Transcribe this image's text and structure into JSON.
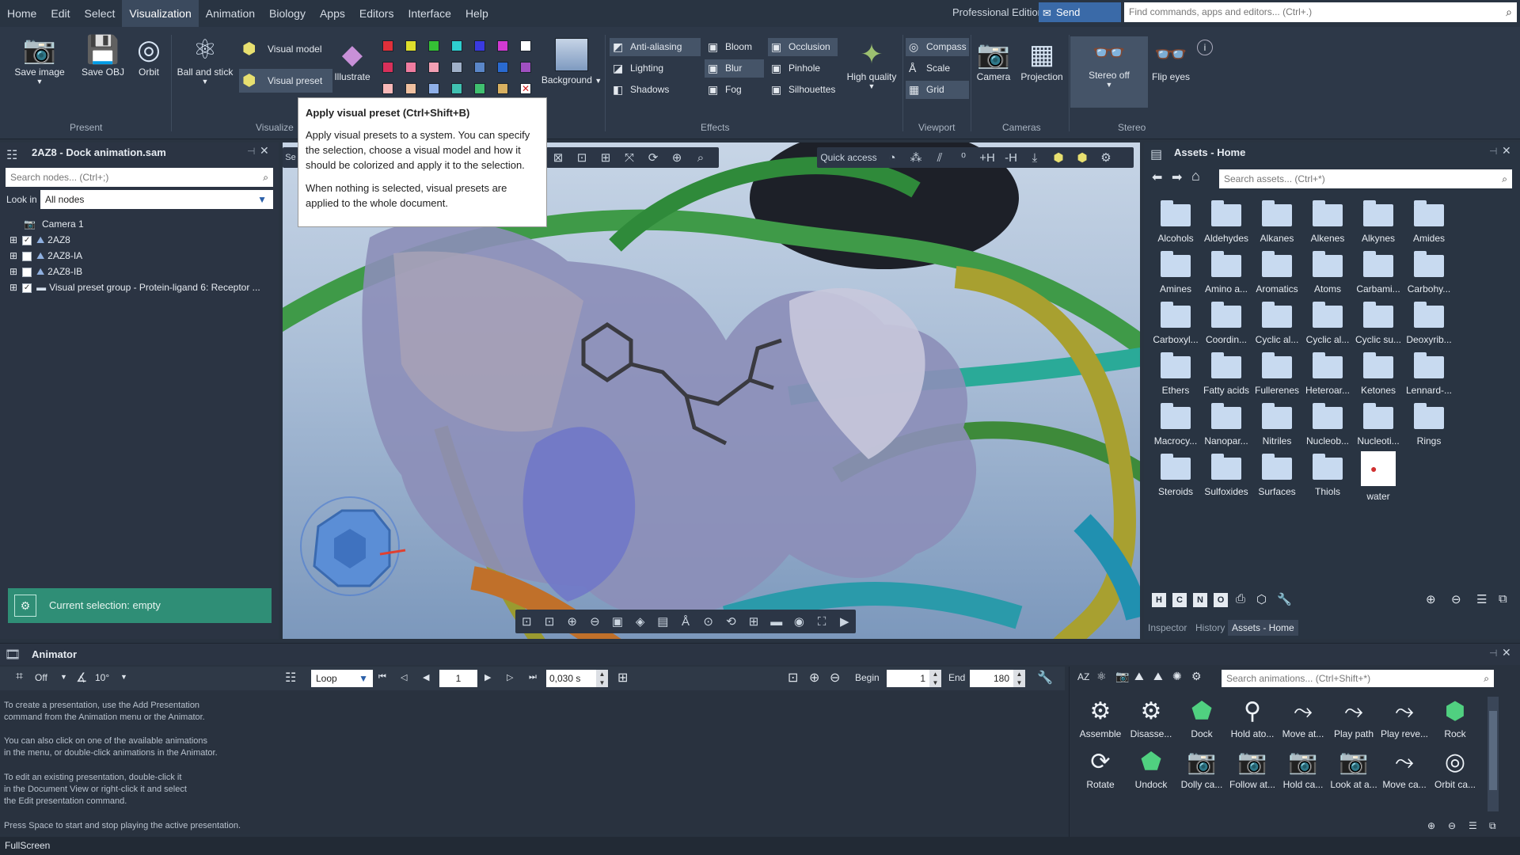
{
  "menu": [
    "Home",
    "Edit",
    "Select",
    "Visualization",
    "Animation",
    "Biology",
    "Apps",
    "Editors",
    "Interface",
    "Help"
  ],
  "menu_active": "Visualization",
  "edition": "Professional Edition",
  "feedback_label": "Send feedback",
  "command_search_placeholder": "Find commands, apps and editors... (Ctrl+.)",
  "ribbon": {
    "save_image": "Save image",
    "save_obj": "Save OBJ",
    "orbit": "Orbit",
    "ball_stick": "Ball and stick",
    "visual_model": "Visual model",
    "visual_preset": "Visual preset",
    "illustrate": "Illustrate",
    "background": "Background",
    "anti_aliasing": "Anti-aliasing",
    "lighting": "Lighting",
    "shadows": "Shadows",
    "bloom": "Bloom",
    "blur": "Blur",
    "fog": "Fog",
    "occlusion": "Occlusion",
    "pinhole": "Pinhole",
    "silhouettes": "Silhouettes",
    "high_quality": "High quality",
    "compass": "Compass",
    "scale": "Scale",
    "grid": "Grid",
    "camera": "Camera",
    "projection": "Projection",
    "stereo_off": "Stereo off",
    "flip_eyes": "Flip eyes",
    "groups": {
      "present": "Present",
      "visualize": "Visualize",
      "effects": "Effects",
      "viewport": "Viewport",
      "cameras": "Cameras",
      "stereo": "Stereo"
    },
    "swatch_colors": [
      "#e0303a",
      "#dede2c",
      "#35c035",
      "#2ecfcf",
      "#3a3ae0",
      "#d23ad2",
      "#ffffff",
      "#d8305a",
      "#f07ca0",
      "#f2a0b4",
      "#a0b0c8",
      "#5a86c8",
      "#2a6ad0",
      "#a050c0",
      "#f8b8b8",
      "#f0c0a0",
      "#8fb0e8",
      "#40c0b0",
      "#40c070",
      "#d8b060"
    ]
  },
  "tooltip": {
    "title": "Apply visual preset (Ctrl+Shift+B)",
    "body1": "Apply visual presets to a system. You can specify the selection, choose a visual model and how it should be colorized and apply it to the selection.",
    "body2": "When nothing is selected, visual presets are applied to the whole document."
  },
  "document": {
    "title": "2AZ8 - Dock animation.sam",
    "search_placeholder": "Search nodes... (Ctrl+;)",
    "look_in_label": "Look in",
    "look_in_value": "All nodes",
    "nodes": [
      "Camera 1",
      "2AZ8",
      "2AZ8-IA",
      "2AZ8-IB",
      "Visual preset group - Protein-ligand 6: Receptor ..."
    ],
    "selection": "Current selection: empty"
  },
  "viewport": {
    "quick_access": "Quick access",
    "hplus": "+H",
    "hminus": "-H"
  },
  "assets": {
    "title": "Assets - Home",
    "search_placeholder": "Search assets... (Ctrl+*)",
    "items": [
      "Alcohols",
      "Aldehydes",
      "Alkanes",
      "Alkenes",
      "Alkynes",
      "Amides",
      "Amines",
      "Amino a...",
      "Aromatics",
      "Atoms",
      "Carbami...",
      "Carbohy...",
      "Carboxyl...",
      "Coordin...",
      "Cyclic al...",
      "Cyclic al...",
      "Cyclic su...",
      "Deoxyrib...",
      "Ethers",
      "Fatty acids",
      "Fullerenes",
      "Heteroar...",
      "Ketones",
      "Lennard-...",
      "Macrocy...",
      "Nanopar...",
      "Nitriles",
      "Nucleob...",
      "Nucleoti...",
      "Rings",
      "Steroids",
      "Sulfoxides",
      "Surfaces",
      "Thiols",
      "water"
    ],
    "filter_buttons": [
      "H",
      "C",
      "N",
      "O"
    ],
    "tabs": [
      "Inspector",
      "History",
      "Assets - Home"
    ]
  },
  "animator": {
    "title": "Animator",
    "off": "Off",
    "angle": "10°",
    "loop": "Loop",
    "frame": "1",
    "time": "0,030 s",
    "begin_label": "Begin",
    "begin_value": "1",
    "end_label": "End",
    "end_value": "180",
    "search_placeholder": "Search animations... (Ctrl+Shift+*)",
    "help": [
      "To create a presentation, use the Add Presentation",
      "command from the Animation menu or the Animator.",
      "You can also click on one of the available animations",
      "in the menu, or double-click animations in the Animator.",
      "To edit an existing presentation, double-click it",
      "in the Document View or right-click it and select",
      "the Edit presentation command.",
      "Press Space to start and stop playing the active presentation."
    ],
    "tiles": [
      "Assemble",
      "Disasse...",
      "Dock",
      "Hold ato...",
      "Move at...",
      "Play path",
      "Play reve...",
      "Rock",
      "Rotate",
      "Undock",
      "Dolly ca...",
      "Follow at...",
      "Hold ca...",
      "Look at a...",
      "Move ca...",
      "Orbit ca..."
    ]
  },
  "status": "FullScreen"
}
